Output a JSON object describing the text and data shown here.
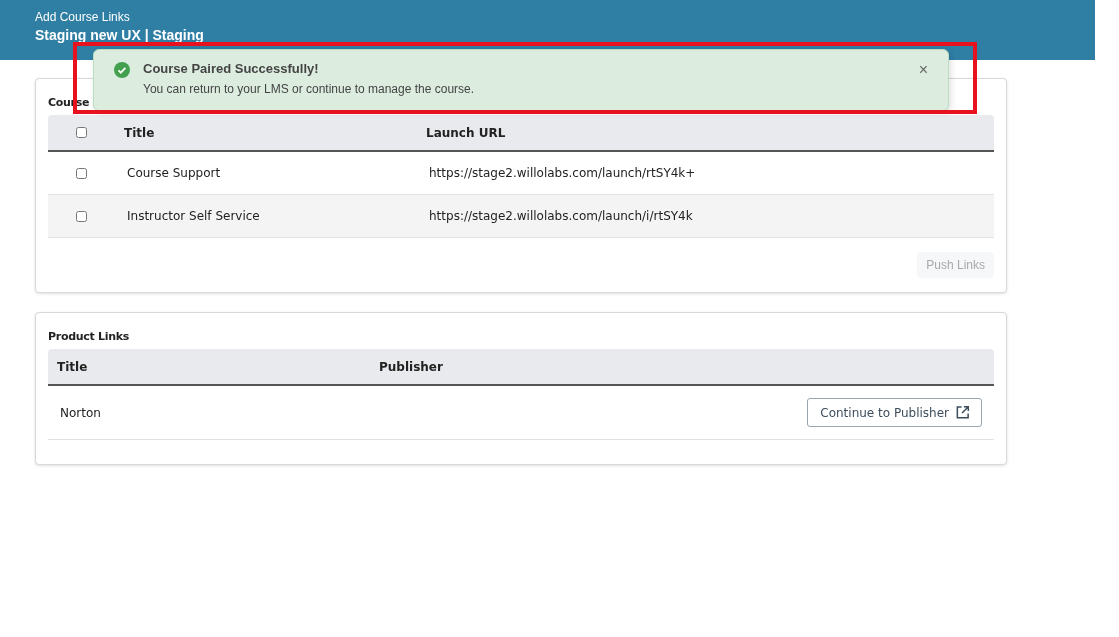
{
  "header": {
    "subtitle": "Add Course Links",
    "title": "Staging new UX | Staging"
  },
  "toast": {
    "kind": "success",
    "highlighted": true,
    "title": "Course Paired Successfully!",
    "message": "You can return to your LMS or continue to manage the course.",
    "close": "×"
  },
  "course_links": {
    "heading": "Course",
    "select_all": {
      "checked": false
    },
    "columns": [
      "Title",
      "Launch URL"
    ],
    "rows": [
      {
        "checked": false,
        "title": "Course Support",
        "url": "https://stage2.willolabs.com/launch/rtSY4k+"
      },
      {
        "checked": false,
        "title": "Instructor Self Service",
        "url": "https://stage2.willolabs.com/launch/i/rtSY4k"
      }
    ],
    "button": {
      "label": "Push Links",
      "disabled": true
    }
  },
  "product_links": {
    "heading": "Product Links",
    "columns": [
      "Title",
      "Publisher"
    ],
    "rows": [
      {
        "title": "Norton",
        "button": "Continue to Publisher"
      }
    ]
  }
}
